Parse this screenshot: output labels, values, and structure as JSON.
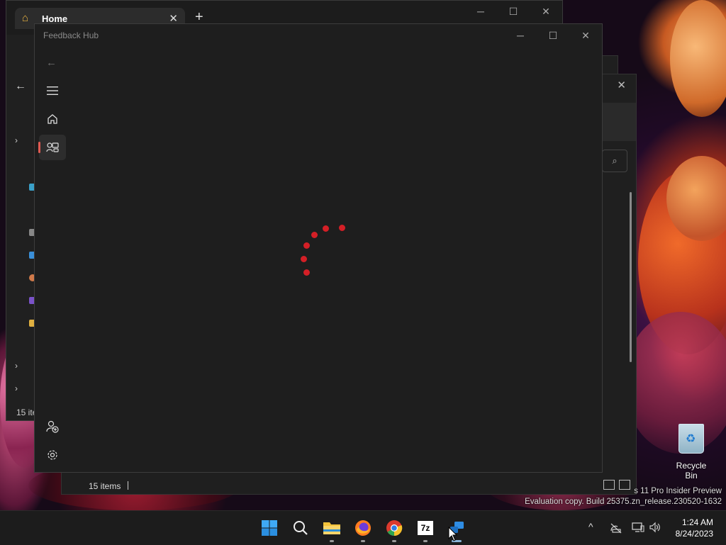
{
  "explorer": {
    "tab_title": "Home",
    "tab_close": "✕",
    "new_tab": "+",
    "status_left": "15 ite",
    "controls": [
      "─",
      "☐",
      "✕"
    ]
  },
  "explorer_back": {
    "items_count": "15 items",
    "close": "✕",
    "search_icon": "⌕"
  },
  "feedback_hub": {
    "title": "Feedback Hub",
    "controls": [
      "─",
      "☐",
      "✕"
    ],
    "back_icon": "←",
    "nav": {
      "menu_icon": "hamburger-menu-icon",
      "home_icon": "home-icon",
      "feedback_icon": "feedback-icon",
      "account_icon": "account-add-icon",
      "settings_icon": "gear-icon"
    },
    "loading": true,
    "accent_color": "#e05a52",
    "spinner_color": "#d41f26"
  },
  "desktop": {
    "recycle_bin_label": "Recycle Bin",
    "watermark_line1": "s 11 Pro Insider Preview",
    "watermark_line2": "Evaluation copy. Build 25375.zn_release.230520-1632"
  },
  "taskbar": {
    "apps": [
      "start-button",
      "search-button",
      "file-explorer",
      "firefox",
      "chrome",
      "7-zip",
      "feedback-hub"
    ],
    "seven_zip_label": "7z",
    "tray_chevron": "^",
    "time": "1:24 AM",
    "date": "8/24/2023"
  }
}
